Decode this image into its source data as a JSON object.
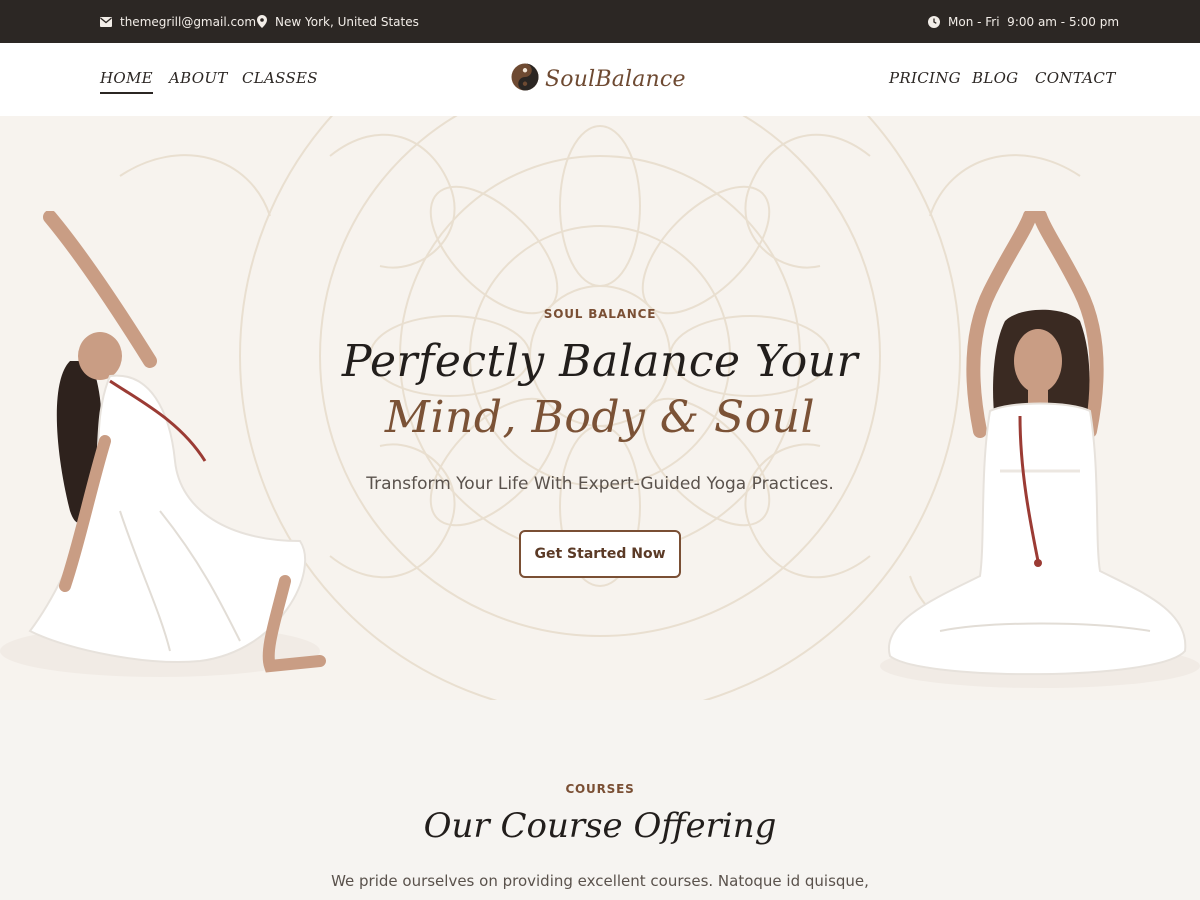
{
  "topbar": {
    "email": "themegrill@gmail.com",
    "location": "New York, United States",
    "hours": "Mon - Fri  9:00 am - 5:00 pm"
  },
  "nav": {
    "left": [
      "HOME",
      "ABOUT",
      "CLASSES"
    ],
    "right": [
      "PRICING",
      "BLOG",
      "CONTACT"
    ],
    "active": "HOME"
  },
  "logo": {
    "text": "SoulBalance"
  },
  "hero": {
    "eyebrow": "SOUL BALANCE",
    "title_line1": "Perfectly Balance Your",
    "title_line2": "Mind, Body & Soul",
    "subtitle": "Transform Your Life With Expert-Guided Yoga Practices.",
    "cta": "Get Started Now"
  },
  "courses": {
    "eyebrow": "COURSES",
    "title": "Our Course Offering",
    "description": "We pride ourselves on providing excellent courses. Natoque id quisque,",
    "description_cont": ""
  },
  "colors": {
    "topbar_bg": "#2c2724",
    "accent_brown": "#7a4f34",
    "hero_bg": "#f7f3ee",
    "text_dark": "#221e1c"
  },
  "icons": [
    "envelope-icon",
    "map-pin-icon",
    "clock-icon",
    "yin-yang-logo-icon"
  ]
}
